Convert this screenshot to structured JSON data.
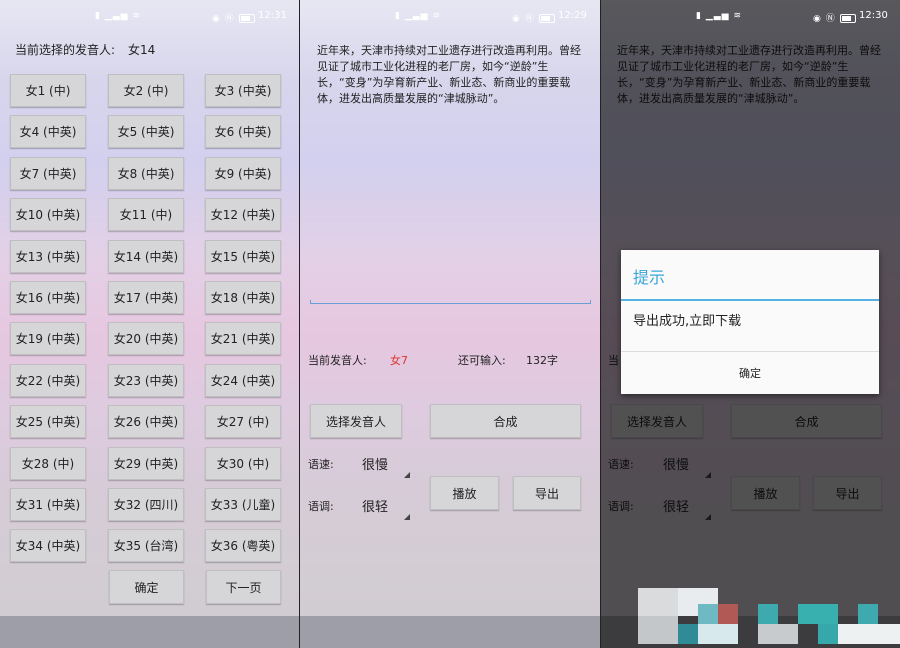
{
  "status_bars": [
    {
      "time": "12:31"
    },
    {
      "time": "12:29"
    },
    {
      "time": "12:30"
    }
  ],
  "screen1": {
    "selected_label": "当前选择的发音人:",
    "selected_value": "女14",
    "voices": [
      "女1 (中)",
      "女2 (中)",
      "女3 (中英)",
      "女4 (中英)",
      "女5 (中英)",
      "女6 (中英)",
      "女7 (中英)",
      "女8 (中英)",
      "女9 (中英)",
      "女10 (中英)",
      "女11 (中)",
      "女12 (中英)",
      "女13 (中英)",
      "女14 (中英)",
      "女15 (中英)",
      "女16 (中英)",
      "女17 (中英)",
      "女18 (中英)",
      "女19 (中英)",
      "女20 (中英)",
      "女21 (中英)",
      "女22 (中英)",
      "女23 (中英)",
      "女24 (中英)",
      "女25 (中英)",
      "女26 (中英)",
      "女27 (中)",
      "女28 (中)",
      "女29 (中英)",
      "女30 (中)",
      "女31 (中英)",
      "女32 (四川)",
      "女33 (儿童)",
      "女34 (中英)",
      "女35 (台湾)",
      "女36 (粤英)"
    ],
    "confirm": "确定",
    "next_page": "下一页"
  },
  "screen2": {
    "text": "近年来，天津市持续对工业遗存进行改造再利用。曾经见证了城市工业化进程的老厂房，如今“逆龄”生长，“变身”为孕育新产业、新业态、新商业的重要载体，进发出高质量发展的“津城脉动”。",
    "speaker_label": "当前发音人:",
    "speaker_value": "女7",
    "remain_label": "还可输入:",
    "remain_value": "132字",
    "select_speaker": "选择发音人",
    "synthesize": "合成",
    "speed_label": "语速:",
    "speed_value": "很慢",
    "pitch_label": "语调:",
    "pitch_value": "很轻",
    "play": "播放",
    "export": "导出"
  },
  "screen3": {
    "dialog_title": "提示",
    "dialog_message": "导出成功,立即下载",
    "dialog_ok": "确定"
  },
  "colors": {
    "speaker_value": "#d8352f",
    "dialog_title": "#3aa5d8"
  }
}
